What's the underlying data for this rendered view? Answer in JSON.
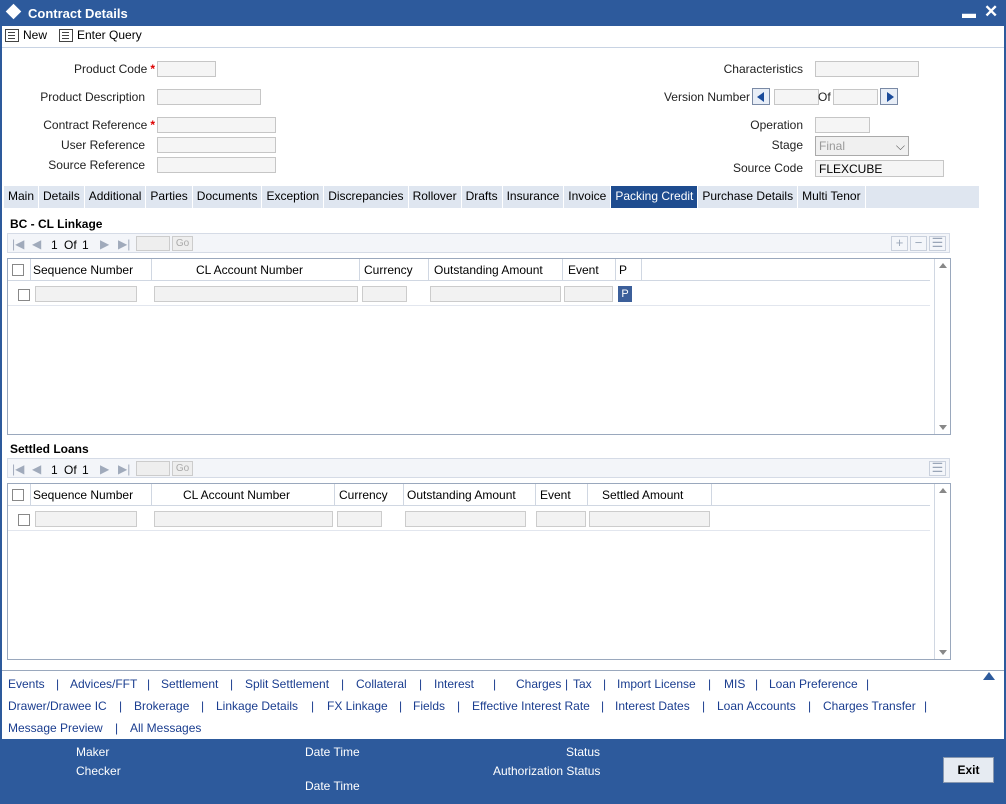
{
  "window": {
    "title": "Contract Details"
  },
  "toolbar": {
    "new_label": "New",
    "enter_query_label": "Enter Query"
  },
  "form": {
    "product_code_label": "Product Code",
    "product_description_label": "Product Description",
    "contract_reference_label": "Contract Reference",
    "user_reference_label": "User Reference",
    "source_reference_label": "Source Reference",
    "required_marker": "*",
    "characteristics_label": "Characteristics",
    "version_number_label": "Version Number",
    "of_label": "Of",
    "operation_label": "Operation",
    "stage_label": "Stage",
    "stage_value": "Final",
    "source_code_label": "Source Code",
    "source_code_value": "FLEXCUBE"
  },
  "tabs": [
    "Main",
    "Details",
    "Additional",
    "Parties",
    "Documents",
    "Exception",
    "Discrepancies",
    "Rollover",
    "Drafts",
    "Insurance",
    "Invoice",
    "Packing Credit",
    "Purchase Details",
    "Multi Tenor"
  ],
  "active_tab": "Packing Credit",
  "bc_cl": {
    "title": "BC - CL Linkage",
    "pager": {
      "page": "1",
      "of_label": "Of",
      "total": "1",
      "go_label": "Go"
    },
    "columns": [
      "Sequence Number",
      "CL Account Number",
      "Currency",
      "Outstanding Amount",
      "Event",
      "P"
    ],
    "p_button_label": "P"
  },
  "settled": {
    "title": "Settled Loans",
    "pager": {
      "page": "1",
      "of_label": "Of",
      "total": "1",
      "go_label": "Go"
    },
    "columns": [
      "Sequence Number",
      "CL Account Number",
      "Currency",
      "Outstanding Amount",
      "Event",
      "Settled Amount"
    ]
  },
  "links": {
    "row1": [
      "Events",
      "Advices/FFT",
      "Settlement",
      "Split Settlement",
      "Collateral",
      "Interest",
      "Charges",
      "Tax",
      "Import License",
      "MIS",
      "Loan Preference"
    ],
    "row2": [
      "Drawer/Drawee IC",
      "Brokerage",
      "Linkage Details",
      "FX Linkage",
      "Fields",
      "Effective Interest Rate",
      "Interest Dates",
      "Loan Accounts",
      "Charges Transfer"
    ],
    "row3": [
      "Message Preview",
      "All Messages"
    ]
  },
  "footer": {
    "maker_label": "Maker",
    "checker_label": "Checker",
    "date_time_label": "Date Time",
    "status_label": "Status",
    "authorization_status_label": "Authorization Status",
    "exit_label": "Exit"
  },
  "colors": {
    "title_bar": "#2d5a9c",
    "active_tab": "#1e4c8f",
    "link": "#1a3d8f"
  }
}
